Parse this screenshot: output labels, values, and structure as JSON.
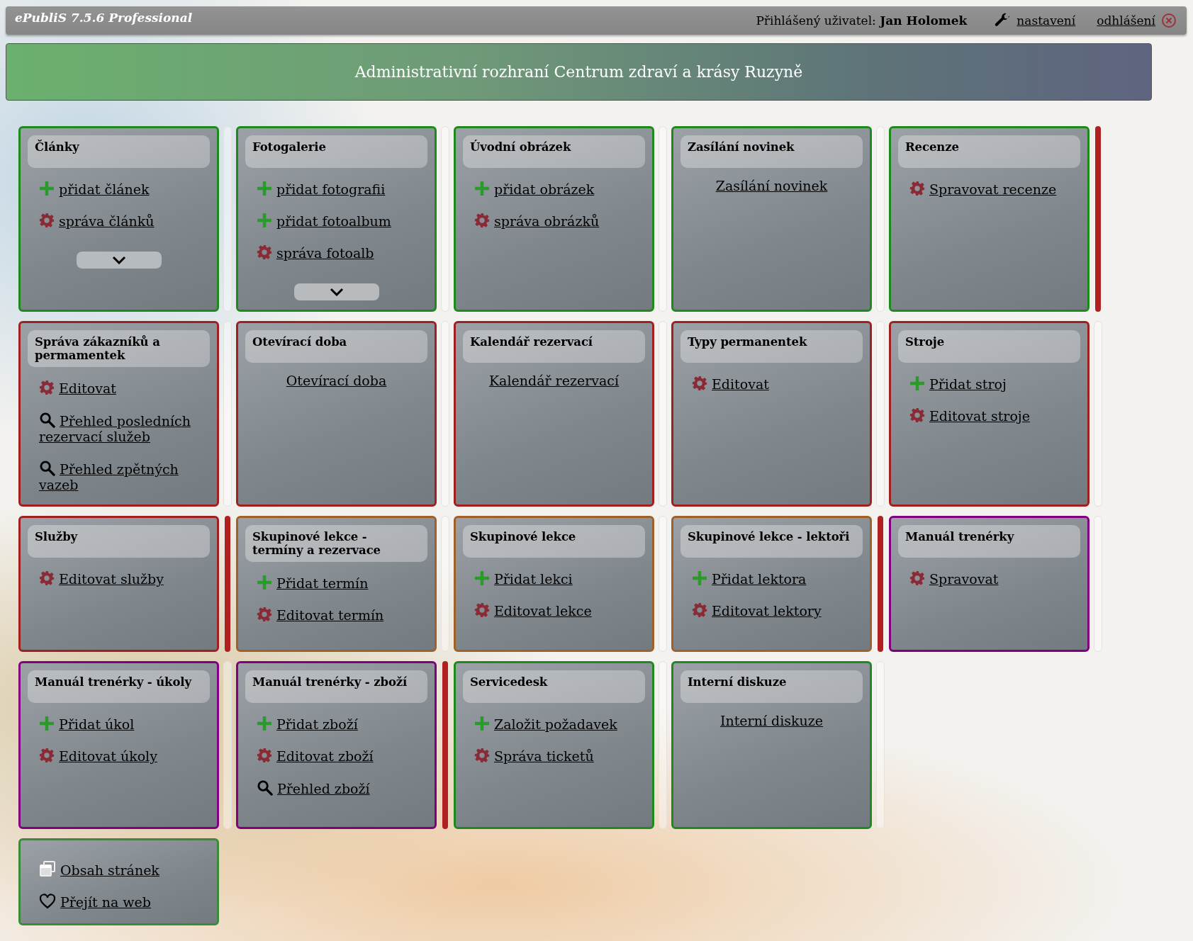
{
  "top_bar": {
    "app_title": "ePubliS 7.5.6 Professional",
    "user": "Přihlášený uživatel: **Jan Holomek**",
    "settings_link": "nastavení",
    "logout_link": "odhlášení"
  },
  "banner": {
    "title": "Administrativní rozhraní Centrum zdraví a krásy Ruzyně"
  },
  "rows": [
    {
      "cards": [
        {
          "title": "Články",
          "color": "#1e8a1e",
          "expandable": true,
          "marked": false,
          "items": [
            {
              "kind": "add",
              "label": "přidat článek"
            },
            {
              "kind": "manage",
              "label": "správa článků"
            }
          ]
        },
        {
          "title": "Fotogalerie",
          "color": "#1e8a1e",
          "expandable": true,
          "marked": false,
          "items": [
            {
              "kind": "add",
              "label": "přidat fotografii"
            },
            {
              "kind": "add",
              "label": "přidat fotoalbum"
            },
            {
              "kind": "manage",
              "label": "správa fotoalb"
            }
          ]
        },
        {
          "title": "Úvodní obrázek",
          "color": "#1e8a1e",
          "expandable": false,
          "marked": false,
          "items": [
            {
              "kind": "add",
              "label": "přidat obrázek"
            },
            {
              "kind": "manage",
              "label": "správa obrázků"
            }
          ]
        },
        {
          "title": "Zasílání novinek",
          "color": "#1e8a1e",
          "expandable": false,
          "marked": false,
          "items": [
            {
              "kind": "plain",
              "label": "Zasílání novinek"
            }
          ]
        },
        {
          "title": "Recenze",
          "color": "#1e8a1e",
          "expandable": false,
          "marked": true,
          "items": [
            {
              "kind": "manage",
              "label": "Spravovat recenze"
            }
          ]
        }
      ]
    },
    {
      "cards": [
        {
          "title": "Správa zákazníků a permamentek",
          "color": "#a02020",
          "expandable": false,
          "marked": false,
          "items": [
            {
              "kind": "manage",
              "label": "Editovat"
            },
            {
              "kind": "view",
              "label": "Přehled posledních rezervací služeb"
            },
            {
              "kind": "view",
              "label": "Přehled zpětných vazeb"
            }
          ]
        },
        {
          "title": "Otevírací doba",
          "color": "#a02020",
          "expandable": false,
          "marked": false,
          "items": [
            {
              "kind": "plain",
              "label": "Otevírací doba"
            }
          ]
        },
        {
          "title": "Kalendář rezervací",
          "color": "#a02020",
          "expandable": false,
          "marked": false,
          "items": [
            {
              "kind": "plain",
              "label": "Kalendář rezervací"
            }
          ]
        },
        {
          "title": "Typy permanentek",
          "color": "#a02020",
          "expandable": false,
          "marked": false,
          "items": [
            {
              "kind": "manage",
              "label": "Editovat"
            }
          ]
        },
        {
          "title": "Stroje",
          "color": "#a02020",
          "expandable": false,
          "marked": false,
          "items": [
            {
              "kind": "add",
              "label": "Přidat stroj"
            },
            {
              "kind": "manage",
              "label": "Editovat stroje"
            }
          ]
        }
      ]
    },
    {
      "cards": [
        {
          "title": "Služby",
          "color": "#a02020",
          "expandable": false,
          "marked": true,
          "items": [
            {
              "kind": "manage",
              "label": "Editovat služby"
            }
          ]
        },
        {
          "title": "Skupinové lekce - termíny a rezervace",
          "color": "#a0602a",
          "expandable": false,
          "marked": false,
          "items": [
            {
              "kind": "add",
              "label": "Přidat termín"
            },
            {
              "kind": "manage",
              "label": "Editovat termín"
            }
          ]
        },
        {
          "title": "Skupinové lekce",
          "color": "#a0602a",
          "expandable": false,
          "marked": false,
          "items": [
            {
              "kind": "add",
              "label": "Přidat lekci"
            },
            {
              "kind": "manage",
              "label": "Editovat lekce"
            }
          ]
        },
        {
          "title": "Skupinové lekce - lektoři",
          "color": "#a0602a",
          "expandable": false,
          "marked": true,
          "items": [
            {
              "kind": "add",
              "label": "Přidat lektora"
            },
            {
              "kind": "manage",
              "label": "Editovat lektory"
            }
          ]
        },
        {
          "title": "Manuál trenérky",
          "color": "#800080",
          "expandable": false,
          "marked": false,
          "items": [
            {
              "kind": "manage",
              "label": "Spravovat"
            }
          ]
        }
      ]
    },
    {
      "cards": [
        {
          "title": "Manuál trenérky - úkoly",
          "color": "#800080",
          "expandable": false,
          "marked": false,
          "items": [
            {
              "kind": "add",
              "label": "Přidat úkol"
            },
            {
              "kind": "manage",
              "label": "Editovat úkoly"
            }
          ]
        },
        {
          "title": "Manuál trenérky - zboží",
          "color": "#800080",
          "expandable": false,
          "marked": true,
          "items": [
            {
              "kind": "add",
              "label": "Přidat zboží"
            },
            {
              "kind": "manage",
              "label": "Editovat zboží"
            },
            {
              "kind": "view",
              "label": "Přehled zboží"
            }
          ]
        },
        {
          "title": "Servicedesk",
          "color": "#1e8a1e",
          "expandable": false,
          "marked": false,
          "items": [
            {
              "kind": "add",
              "label": "Založit požadavek"
            },
            {
              "kind": "manage",
              "label": "Správa ticketů"
            }
          ]
        },
        {
          "title": "Interní diskuze",
          "color": "#1e8a1e",
          "expandable": false,
          "marked": false,
          "items": [
            {
              "kind": "plain",
              "label": "Interní diskuze"
            }
          ]
        }
      ]
    }
  ],
  "footer_card": {
    "color": "#3a8a3a",
    "items": [
      {
        "kind": "pages",
        "label": "Obsah stránek"
      },
      {
        "kind": "web",
        "label": "Přejít na web"
      }
    ]
  }
}
